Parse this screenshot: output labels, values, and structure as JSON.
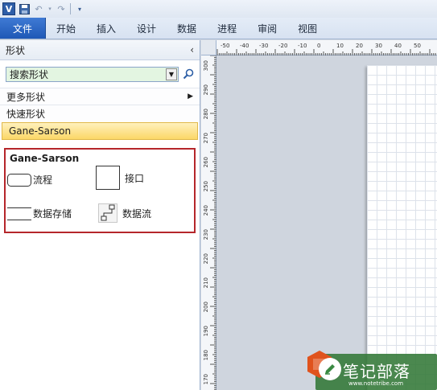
{
  "ribbon": {
    "file_tab": "文件",
    "tabs": [
      "开始",
      "插入",
      "设计",
      "数据",
      "进程",
      "审阅",
      "视图"
    ]
  },
  "shapes_pane": {
    "title": "形状",
    "search": {
      "value": "搜索形状"
    },
    "more_shapes": "更多形状",
    "quick_shapes": "快速形状",
    "stencil_tab": "Gane-Sarson",
    "stencil": {
      "title": "Gane-Sarson",
      "shapes": [
        "流程",
        "接口",
        "数据存储",
        "数据流"
      ]
    }
  },
  "ruler": {
    "top_ticks": [
      "-50",
      "-40",
      "-30",
      "-20",
      "-10",
      "0",
      "10",
      "20",
      "30",
      "40",
      "50"
    ],
    "left_ticks": [
      "300",
      "290",
      "280",
      "270",
      "260",
      "250",
      "240",
      "230",
      "220",
      "210",
      "200",
      "190",
      "180",
      "170"
    ]
  },
  "watermark": {
    "text": "笔记部落",
    "url": "www.notetribe.com"
  },
  "colors": {
    "file_tab": "#2b66c4",
    "search_bg": "#e3f5e1",
    "stencil_tab": "#fbd767",
    "highlight_border": "#b5262b",
    "watermark": "#32783a"
  }
}
